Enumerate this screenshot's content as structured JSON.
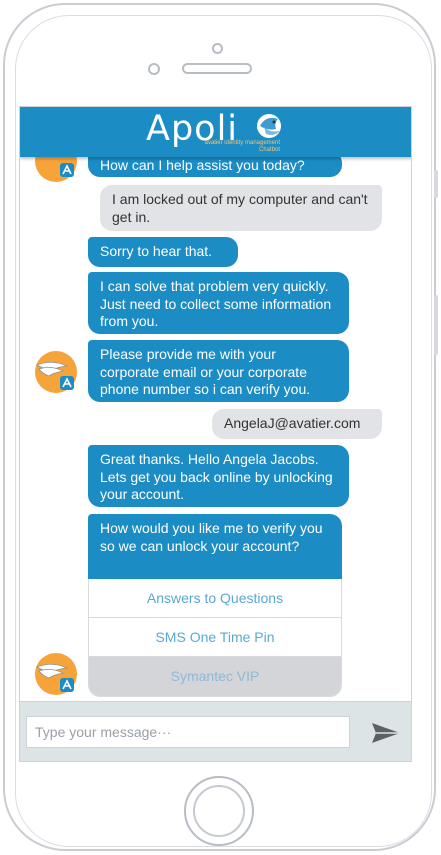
{
  "header": {
    "brand": "Apoli",
    "tagline_line1": "avatier identity management",
    "tagline_line2": "Chatbot"
  },
  "messages": [
    {
      "from": "bot",
      "text": "How can I help assist you today?"
    },
    {
      "from": "user",
      "text": "I am locked out of my computer and can't get in."
    },
    {
      "from": "bot",
      "text": "Sorry to hear that."
    },
    {
      "from": "bot",
      "text": "I can solve that problem very quickly.  Just need to collect some information from you."
    },
    {
      "from": "bot",
      "text": "Please provide me with your corporate email or your corporate phone number so i can verify you."
    },
    {
      "from": "user",
      "text": "AngelaJ@avatier.com"
    },
    {
      "from": "bot",
      "text": "Great thanks.  Hello Angela Jacobs.  Lets get you back online by unlocking your account."
    },
    {
      "from": "bot",
      "text": "How would you like me to verify you so we can unlock your account?"
    }
  ],
  "quick_replies": [
    {
      "label": "Answers to Questions",
      "state": "enabled"
    },
    {
      "label": "SMS One Time Pin",
      "state": "enabled"
    },
    {
      "label": "Symantec VIP",
      "state": "disabled"
    }
  ],
  "composer": {
    "placeholder": "Type your message···",
    "send_icon": "send-arrow-icon"
  },
  "colors": {
    "header_blue": "#1b8cc4",
    "bot_bubble": "#1b8cc4",
    "user_bubble": "#e1e3e6",
    "avatar_orange": "#f6a33a"
  }
}
